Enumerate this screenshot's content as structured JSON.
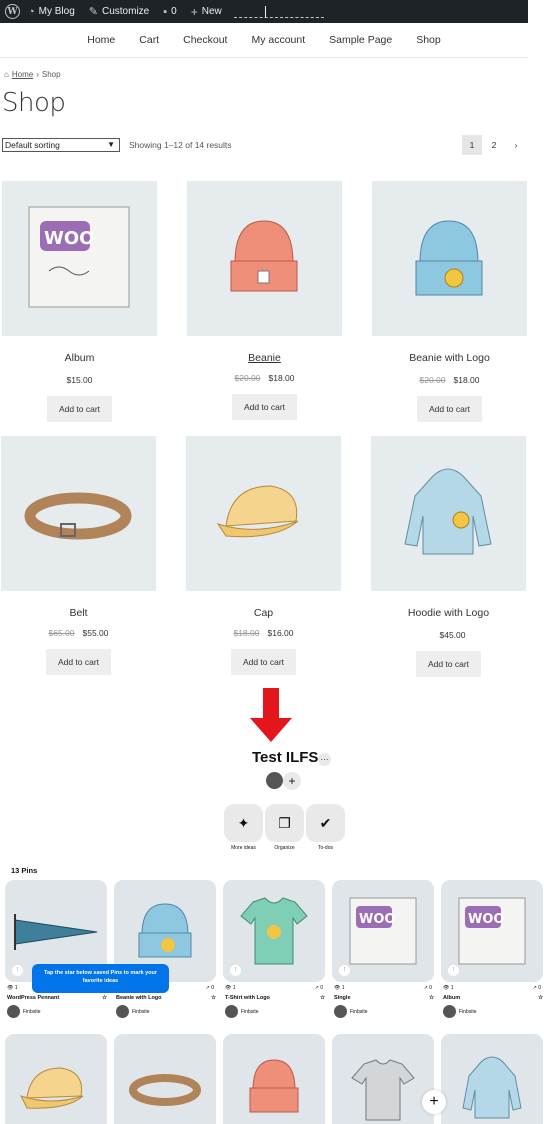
{
  "adminbar": {
    "site": "My Blog",
    "customize": "Customize",
    "comments": "0",
    "new": "New"
  },
  "nav": [
    "Home",
    "Cart",
    "Checkout",
    "My account",
    "Sample Page",
    "Shop"
  ],
  "breadcrumb": {
    "home": "Home",
    "sep": "›",
    "current": "Shop"
  },
  "page_title": "Shop",
  "sorting": {
    "selected": "Default sorting"
  },
  "showing": "Showing 1–12 of 14 results",
  "pagination": [
    "1",
    "2",
    "›"
  ],
  "products": [
    {
      "name": "Album",
      "old_price": "",
      "price": "$15.00",
      "button": "Add to cart"
    },
    {
      "name": "Beanie",
      "old_price": "$20.00",
      "price": "$18.00",
      "button": "Add to cart"
    },
    {
      "name": "Beanie with Logo",
      "old_price": "$20.00",
      "price": "$18.00",
      "button": "Add to cart"
    },
    {
      "name": "Belt",
      "old_price": "$65.00",
      "price": "$55.00",
      "button": "Add to cart"
    },
    {
      "name": "Cap",
      "old_price": "$18.00",
      "price": "$16.00",
      "button": "Add to cart"
    },
    {
      "name": "Hoodie with Logo",
      "old_price": "",
      "price": "$45.00",
      "button": "Add to cart"
    }
  ],
  "board": {
    "title": "Test ILFS",
    "more": "···",
    "tools": [
      "More ideas",
      "Organize",
      "To-dos"
    ],
    "pin_count": "13 Pins",
    "tip": "Tap the star below saved Pins to mark your favorite ideas",
    "pins": [
      {
        "title": "WordPress Pennant",
        "owner": "Finbsite",
        "views": "1",
        "saves": "0"
      },
      {
        "title": "Beanie with Logo",
        "owner": "Finbsite",
        "views": "1",
        "saves": "0"
      },
      {
        "title": "T-Shirt with Logo",
        "owner": "Finbsite",
        "views": "1",
        "saves": "0"
      },
      {
        "title": "Single",
        "owner": "Finbsite",
        "views": "1",
        "saves": "0"
      },
      {
        "title": "Album",
        "owner": "Finbsite",
        "views": "1",
        "saves": "0"
      }
    ]
  },
  "colors": {
    "adminbar": "#1d2327",
    "arrow": "#e3161b",
    "tip": "#0074e8",
    "product_bg": "#e6ebee"
  }
}
